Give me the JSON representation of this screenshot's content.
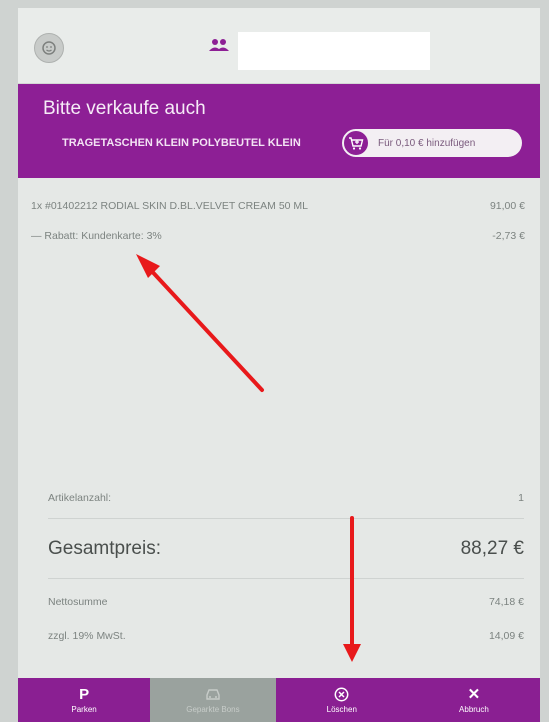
{
  "colors": {
    "brand": "#8d1f95",
    "bottom_bar": "#8a1f92",
    "disabled": "#9aa29e",
    "annotation": "#e8191b"
  },
  "header": {
    "avatar_icon": "face-icon",
    "user_icon": "users-icon"
  },
  "upsell": {
    "title": "Bitte verkaufe auch",
    "product": "TRAGETASCHEN KLEIN POLYBEUTEL KLEIN",
    "add_icon": "cart-plus-icon",
    "add_label": "Für 0,10 € hinzufügen"
  },
  "items": [
    {
      "text": "1x #01402212 RODIAL SKIN D.BL.VELVET CREAM 50 ML",
      "price": "91,00 €"
    },
    {
      "text": "— Rabatt: Kundenkarte: 3%",
      "price": "-2,73 €"
    }
  ],
  "summary": {
    "article_count_label": "Artikelanzahl:",
    "article_count": "1",
    "total_label": "Gesamtpreis:",
    "total_value": "88,27 €",
    "net_label": "Nettosumme",
    "net_value": "74,18 €",
    "vat_label": "zzgl. 19% MwSt.",
    "vat_value": "14,09 €"
  },
  "bottom_bar": {
    "park": {
      "glyph": "P",
      "label": "Parken"
    },
    "parked": {
      "icon": "car-icon",
      "label": "Geparkte Bons"
    },
    "delete": {
      "icon": "circle-x-icon",
      "label": "Löschen"
    },
    "cancel": {
      "glyph": "✕",
      "label": "Abbruch"
    }
  }
}
